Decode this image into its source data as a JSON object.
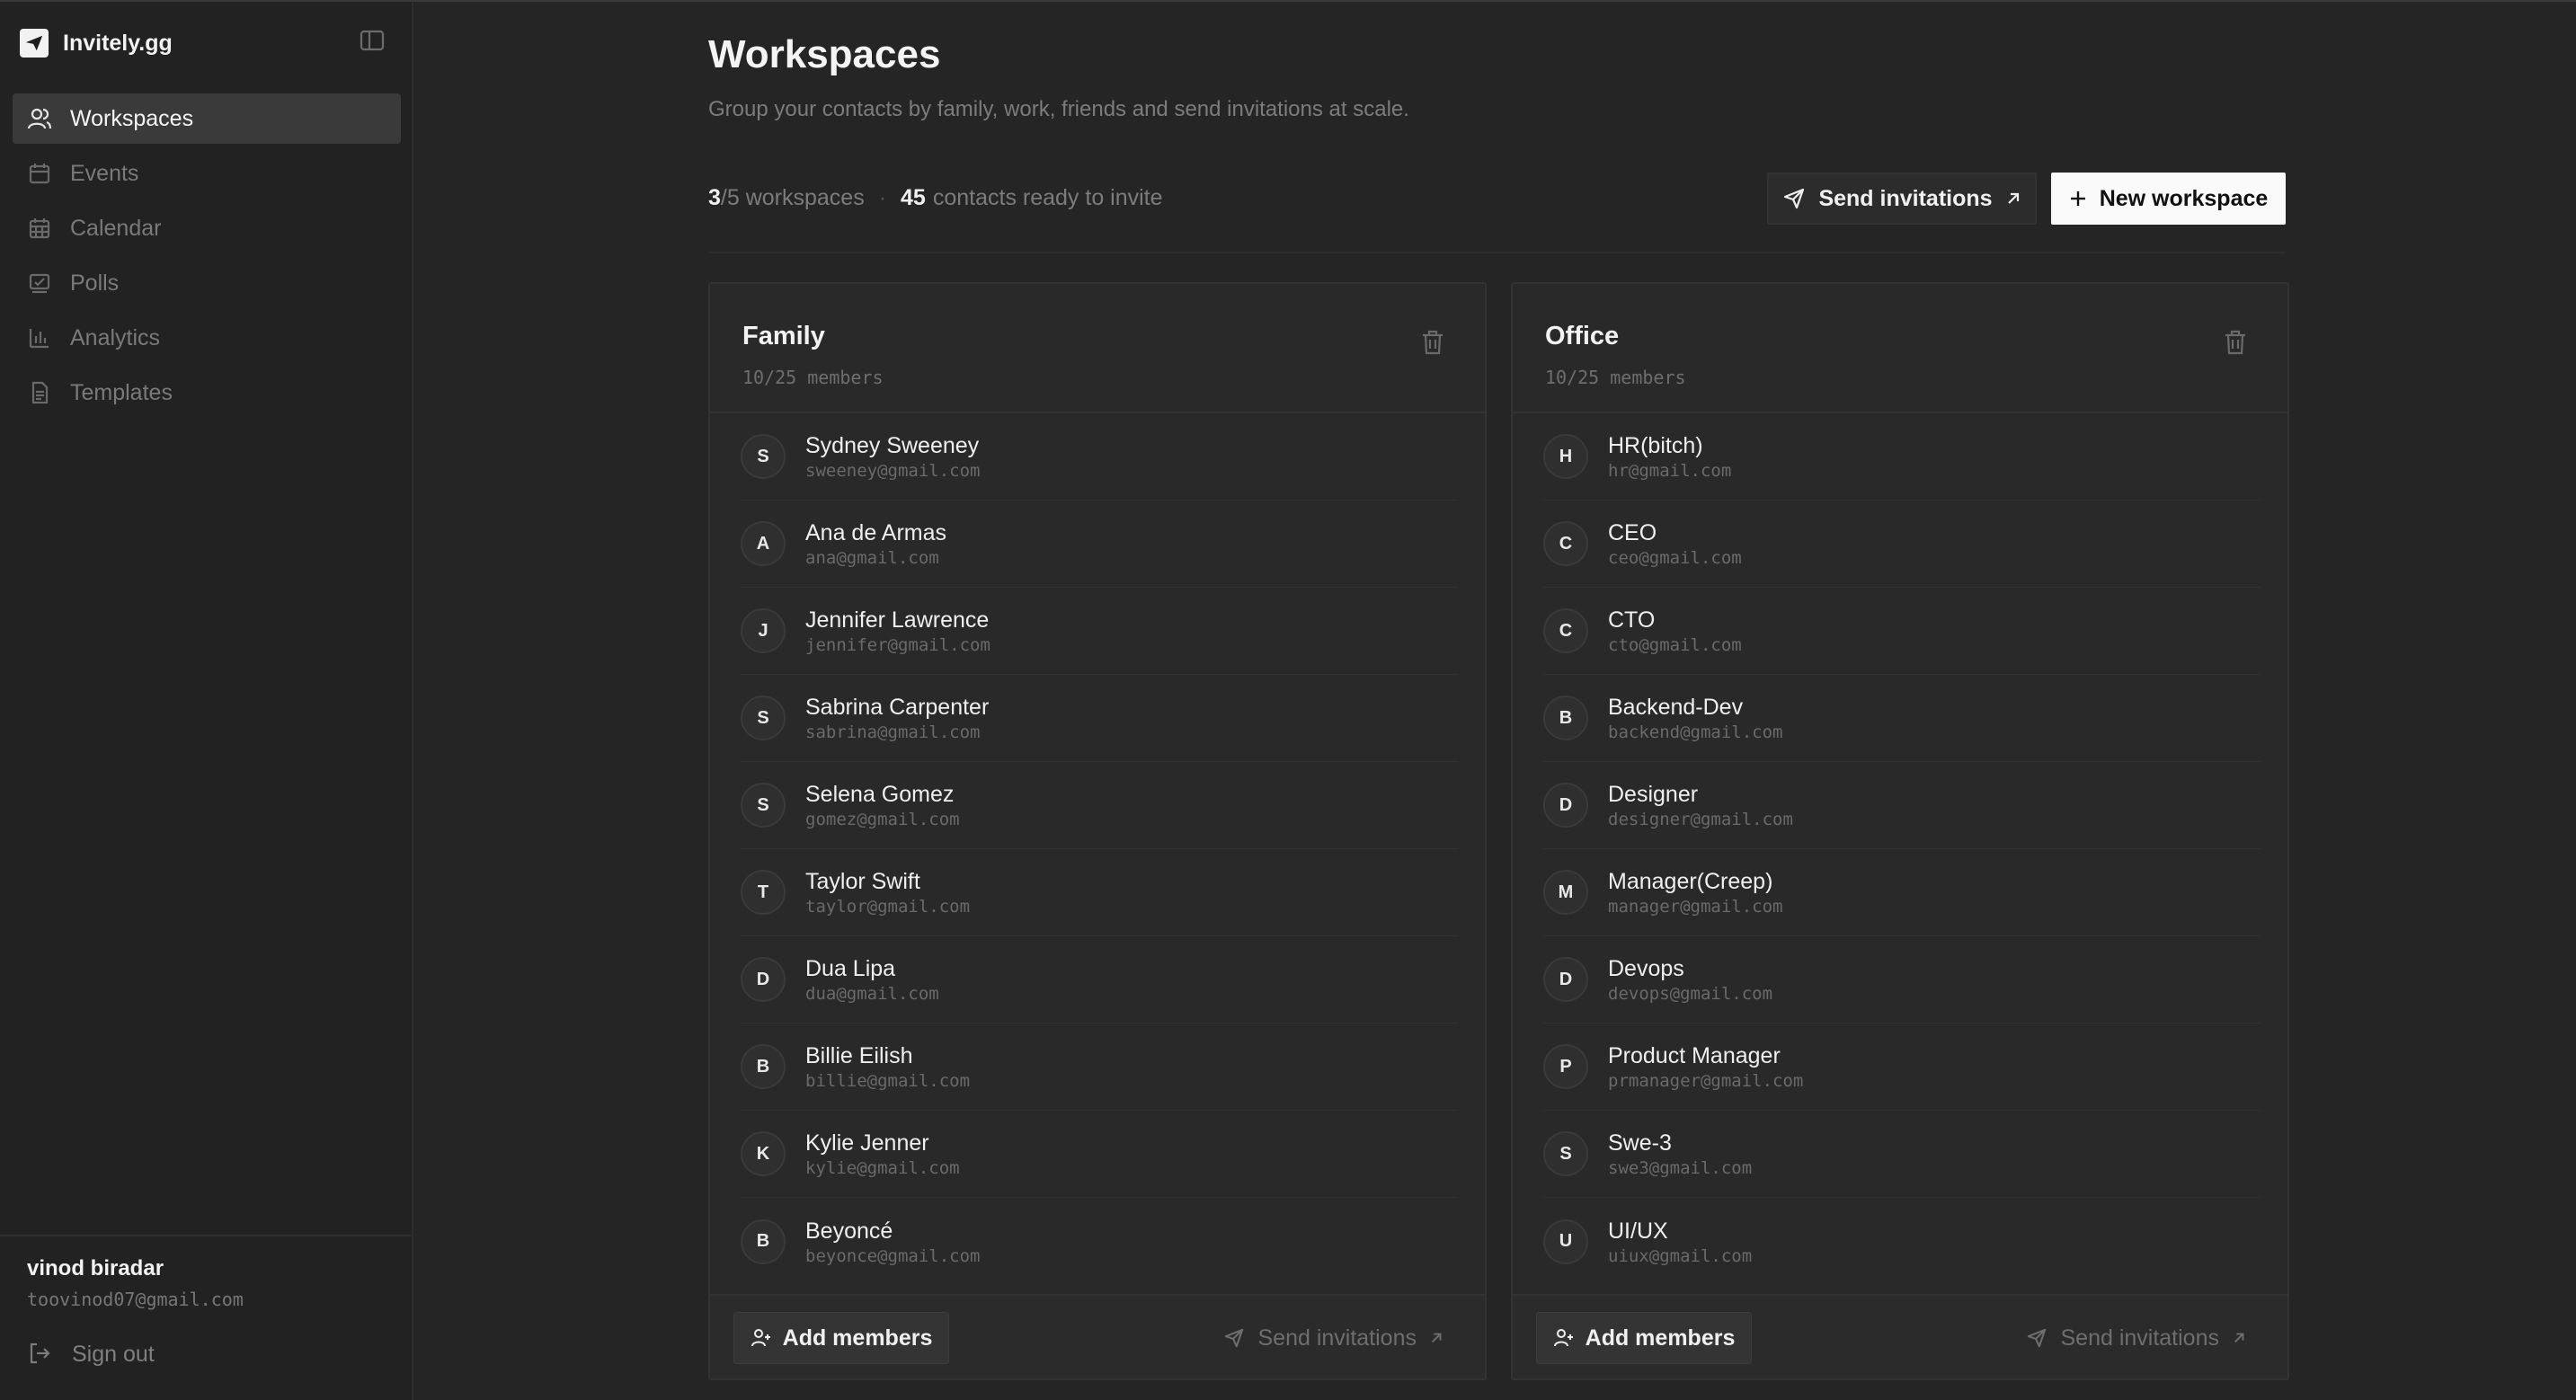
{
  "app": {
    "name": "Invitely.gg"
  },
  "sidebar": {
    "items": [
      {
        "label": "Workspaces",
        "icon": "users-icon",
        "active": true
      },
      {
        "label": "Events",
        "icon": "calendar-icon",
        "active": false
      },
      {
        "label": "Calendar",
        "icon": "calendar-grid-icon",
        "active": false
      },
      {
        "label": "Polls",
        "icon": "poll-icon",
        "active": false
      },
      {
        "label": "Analytics",
        "icon": "bar-chart-icon",
        "active": false
      },
      {
        "label": "Templates",
        "icon": "document-icon",
        "active": false
      }
    ],
    "user": {
      "name": "vinod biradar",
      "email": "toovinod07@gmail.com"
    },
    "sign_out": "Sign out"
  },
  "page": {
    "title": "Workspaces",
    "subtitle": "Group your contacts by family, work, friends and send invitations at scale.",
    "stats": {
      "used": "3",
      "limit": "/5 workspaces",
      "separator": "·",
      "contacts": "45",
      "contacts_label": "contacts ready to invite"
    },
    "send_invitations": "Send invitations",
    "new_workspace": "New workspace"
  },
  "workspaces": [
    {
      "name": "Family",
      "count": "10/25 members",
      "members": [
        {
          "initial": "S",
          "name": "Sydney Sweeney",
          "email": "sweeney@gmail.com"
        },
        {
          "initial": "A",
          "name": "Ana de Armas",
          "email": "ana@gmail.com"
        },
        {
          "initial": "J",
          "name": "Jennifer Lawrence",
          "email": "jennifer@gmail.com"
        },
        {
          "initial": "S",
          "name": "Sabrina Carpenter",
          "email": "sabrina@gmail.com"
        },
        {
          "initial": "S",
          "name": "Selena Gomez",
          "email": "gomez@gmail.com"
        },
        {
          "initial": "T",
          "name": "Taylor Swift",
          "email": "taylor@gmail.com"
        },
        {
          "initial": "D",
          "name": "Dua Lipa",
          "email": "dua@gmail.com"
        },
        {
          "initial": "B",
          "name": "Billie Eilish",
          "email": "billie@gmail.com"
        },
        {
          "initial": "K",
          "name": "Kylie Jenner",
          "email": "kylie@gmail.com"
        },
        {
          "initial": "B",
          "name": "Beyoncé",
          "email": "beyonce@gmail.com"
        }
      ],
      "add_members": "Add members",
      "send_invitations": "Send invitations"
    },
    {
      "name": "Office",
      "count": "10/25 members",
      "members": [
        {
          "initial": "H",
          "name": "HR(bitch)",
          "email": "hr@gmail.com"
        },
        {
          "initial": "C",
          "name": "CEO",
          "email": "ceo@gmail.com"
        },
        {
          "initial": "C",
          "name": "CTO",
          "email": "cto@gmail.com"
        },
        {
          "initial": "B",
          "name": "Backend-Dev",
          "email": "backend@gmail.com"
        },
        {
          "initial": "D",
          "name": "Designer",
          "email": "designer@gmail.com"
        },
        {
          "initial": "M",
          "name": "Manager(Creep)",
          "email": "manager@gmail.com"
        },
        {
          "initial": "D",
          "name": "Devops",
          "email": "devops@gmail.com"
        },
        {
          "initial": "P",
          "name": "Product Manager",
          "email": "prmanager@gmail.com"
        },
        {
          "initial": "S",
          "name": "Swe-3",
          "email": "swe3@gmail.com"
        },
        {
          "initial": "U",
          "name": "UI/UX",
          "email": "uiux@gmail.com"
        }
      ],
      "add_members": "Add members",
      "send_invitations": "Send invitations"
    }
  ],
  "colors": {
    "background": "#252525",
    "sidebar": "#222222",
    "primary_button": "#fafafa",
    "card": "#292929"
  }
}
